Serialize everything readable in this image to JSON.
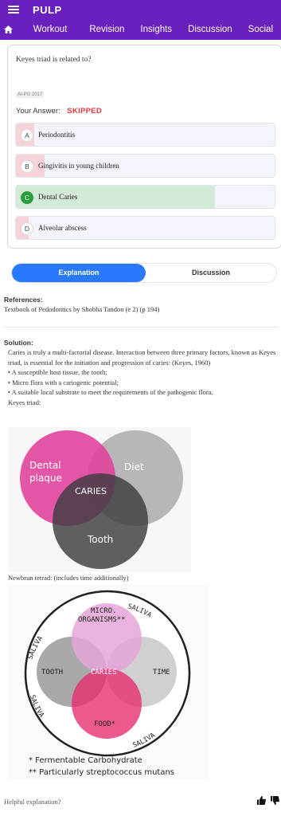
{
  "app": {
    "title": "PULP"
  },
  "nav": {
    "tabs": [
      "Workout",
      "Revision",
      "Insights",
      "Discussion",
      "Social"
    ]
  },
  "question": {
    "text": "Keyes triad is related to?",
    "source": "AI-PG 2017",
    "your_answer_label": "Your Answer:",
    "your_answer_value": "SKIPPED",
    "options": [
      {
        "letter": "A",
        "text": "Periodontitis",
        "percent": 7,
        "correct": false
      },
      {
        "letter": "B",
        "text": "Gingivitis in young children",
        "percent": 11,
        "correct": false
      },
      {
        "letter": "C",
        "text": "Dental Caries",
        "percent": 77,
        "correct": true
      },
      {
        "letter": "D",
        "text": "Alveolar abscess",
        "percent": 5,
        "correct": false
      }
    ]
  },
  "tabs": {
    "explanation": "Explanation",
    "discussion": "Discussion"
  },
  "references": {
    "heading": "References:",
    "text": "Textbook of Pedodontics by Shobha Tandon (e 2) (p 194)"
  },
  "solution": {
    "heading": "Solution:",
    "lines": [
      "Caries is truly a multi-factorial disease. Interaction between three primary factors, known as Keyes triad, is essential for the initiation and progression of caries: (Keyes, 1960)",
      "• A susceptible host tissue, the tooth;",
      "• Micro flora with a cariogenic potential;",
      "• A suitable local substrate to meet the requirements of the pathogenic flora.",
      "Keyes triad:"
    ]
  },
  "figure1": {
    "labels": [
      "Dental",
      "plaque",
      "Diet",
      "CARIES",
      "Tooth"
    ]
  },
  "figure2": {
    "caption": "Newbrun tetrad: (includes time additionally)",
    "labels": [
      "MICRO.",
      "ORGANISMS**",
      "TOOTH",
      "CARIES",
      "TIME",
      "FOOD*",
      "SALIVA"
    ],
    "footnotes": [
      "* Fermentable Carbohydrate",
      "** Particularly streptococcus mutans"
    ]
  },
  "feedback": {
    "prompt": "Helpful explanation?"
  },
  "colors": {
    "primary": "#6a1fbf",
    "accent": "#2979ff",
    "correct": "#2a9d3f",
    "skipped": "#e53935"
  }
}
